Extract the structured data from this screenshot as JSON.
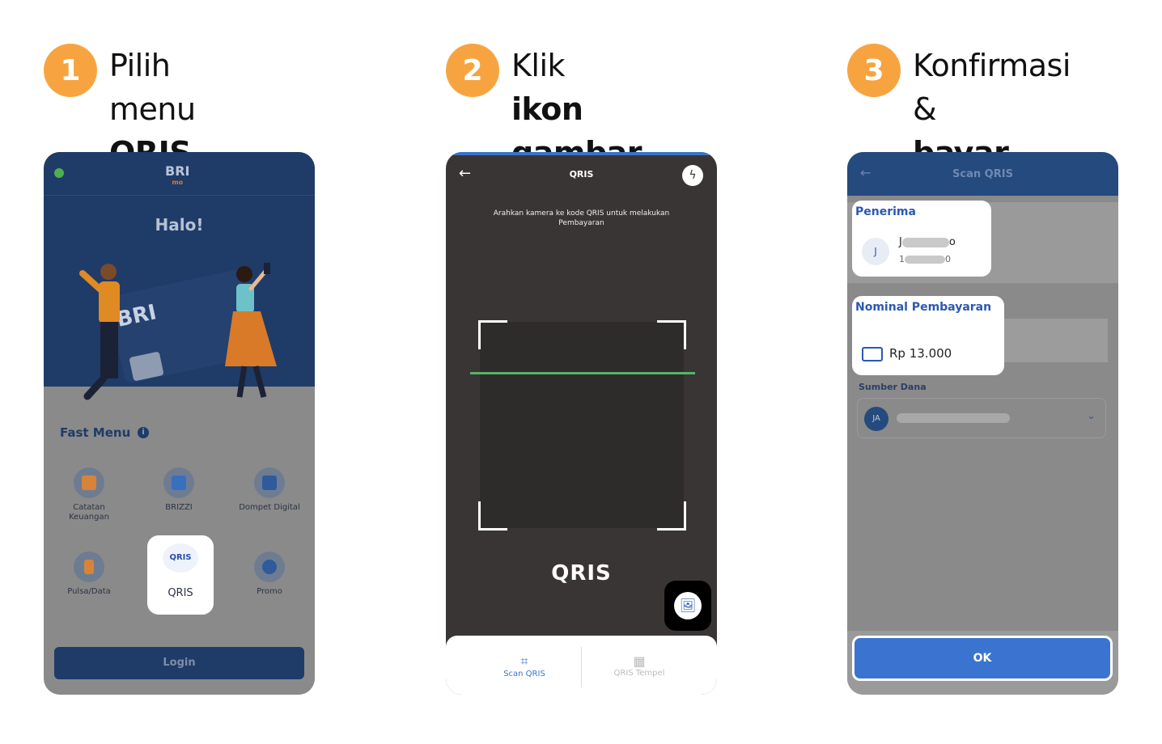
{
  "steps": [
    {
      "number": "1",
      "title_plain": "Pilih menu",
      "title_bold": "QRIS"
    },
    {
      "number": "2",
      "title_plain": "Klik ",
      "title_bold_inline": "ikon",
      "title_bold": "gambar"
    },
    {
      "number": "3",
      "title_plain": "Konfirmasi &",
      "title_bold": "bayar"
    }
  ],
  "phone1": {
    "brand": "BRI",
    "brand_sub": "mo",
    "greeting": "Halo!",
    "card_logo": "BRI",
    "fast_menu_label": "Fast Menu",
    "info_icon": "i",
    "menu": [
      {
        "label": "Catatan Keuangan"
      },
      {
        "label": "BRIZZI"
      },
      {
        "label": "Dompet Digital"
      },
      {
        "label": "Pulsa/Data"
      },
      {
        "label": "QRIS",
        "icon_text": "QRIS"
      },
      {
        "label": "Promo"
      }
    ],
    "login_label": "Login"
  },
  "phone2": {
    "back_icon": "←",
    "title": "QRIS",
    "flash_icon": "ϟ",
    "instruction": "Arahkan kamera ke kode QRIS untuk melakukan Pembayaran",
    "logo": "QRIS",
    "gallery_icon": "🖼",
    "tabs": [
      {
        "icon": "⌗",
        "label": "Scan QRIS"
      },
      {
        "icon": "▦",
        "label": "QRIS Tempel"
      }
    ]
  },
  "phone3": {
    "back_icon": "←",
    "title": "Scan QRIS",
    "penerima_label": "Penerima",
    "avatar": "J",
    "name_start": "J",
    "name_end": "o",
    "acct_start": "1",
    "acct_end": "0",
    "nominal_label": "Nominal Pembayaran",
    "amount": "Rp 13.000",
    "sumber_dana_label": "Sumber Dana",
    "sumber_avatar": "JA",
    "chevron_icon": "⌄",
    "ok_label": "OK"
  },
  "colors": {
    "accent_orange": "#F7A440",
    "bri_blue": "#1f3b68",
    "scan_green": "#56b36a",
    "ok_blue": "#3a74d0"
  }
}
